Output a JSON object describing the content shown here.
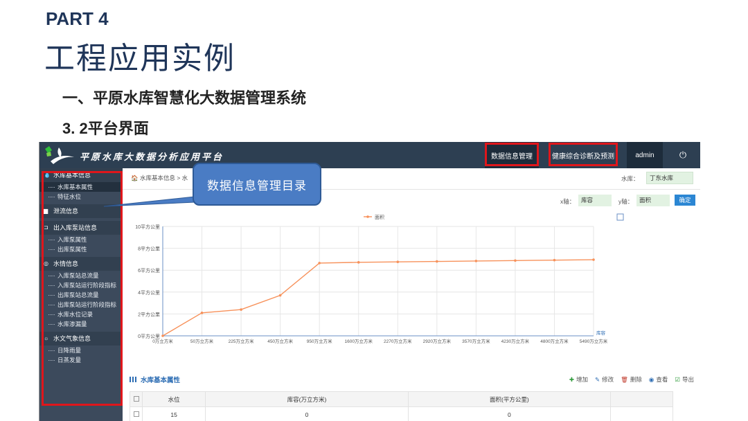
{
  "slide": {
    "part": "PART 4",
    "title": "工程应用实例",
    "heading1": "一、平原水库智慧化大数据管理系统",
    "heading2": "3. 2平台界面",
    "callout": "数据信息管理目录"
  },
  "app": {
    "brand": "平原水库大数据分析应用平台",
    "nav": {
      "data_mgmt": "数据信息管理",
      "health": "健康综合诊断及预测",
      "admin": "admin",
      "power_icon": "⏻"
    },
    "sidebar": [
      {
        "label": "水库基本信息",
        "icon": "💧",
        "items": [
          {
            "label": "水库基本属性",
            "selected": true
          },
          {
            "label": "特征水位"
          }
        ]
      },
      {
        "label": "泄流信息",
        "icon": "▆",
        "items": []
      },
      {
        "label": "出入库泵站信息",
        "icon": "⊐",
        "items": [
          {
            "label": "入库泵属性"
          },
          {
            "label": "出库泵属性"
          }
        ]
      },
      {
        "label": "水情信息",
        "icon": "◎",
        "items": [
          {
            "label": "入库泵站总流量"
          },
          {
            "label": "入库泵站运行阶段指标"
          },
          {
            "label": "出库泵站总流量"
          },
          {
            "label": "出库泵站运行阶段指标"
          },
          {
            "label": "水库水位记录"
          },
          {
            "label": "水库渗漏量"
          }
        ]
      },
      {
        "label": "水文气象信息",
        "icon": "☼",
        "items": [
          {
            "label": "日降雨量"
          },
          {
            "label": "日蒸发量"
          }
        ]
      }
    ],
    "breadcrumb": "水库基本信息 > 水",
    "reservoir_label": "水库：",
    "reservoir_value": "丁东水库",
    "x_axis_label": "x轴：",
    "x_axis_value": "库容",
    "y_axis_label": "y轴：",
    "y_axis_value": "面积",
    "confirm": "确定",
    "table": {
      "title": "水库基本属性",
      "tools": [
        {
          "icon": "✚",
          "label": "增加",
          "color": "#2e9b3a"
        },
        {
          "icon": "✎",
          "label": "修改",
          "color": "#2b6cb3"
        },
        {
          "icon": "🗑",
          "label": "删除",
          "color": "#c0392b"
        },
        {
          "icon": "◉",
          "label": "查看",
          "color": "#2b6cb3"
        },
        {
          "icon": "☑",
          "label": "导出",
          "color": "#2e9b3a"
        }
      ],
      "columns": [
        "水位",
        "库容(万立方米)",
        "面积(平方公里)"
      ],
      "rows": [
        [
          "15",
          "0",
          "0"
        ]
      ]
    }
  },
  "chart_data": {
    "type": "line",
    "legend": "面积",
    "legend_position": "top-center",
    "x_unit_label": "库容",
    "categories": [
      "0万立方米",
      "50万立方米",
      "225万立方米",
      "450万立方米",
      "950万立方米",
      "1600万立方米",
      "2270万立方米",
      "2920万立方米",
      "3570万立方米",
      "4230万立方米",
      "4800万立方米",
      "5490万立方米"
    ],
    "series": [
      {
        "name": "面积",
        "values": [
          0,
          2.1,
          2.4,
          3.7,
          6.65,
          6.72,
          6.76,
          6.8,
          6.84,
          6.88,
          6.92,
          6.96
        ]
      }
    ],
    "y_ticks": [
      "0平方公里",
      "2平方公里",
      "4平方公里",
      "6平方公里",
      "8平方公里",
      "10平方公里"
    ],
    "ylim": [
      0,
      10
    ],
    "grid": true,
    "line_color": "#f7915a"
  }
}
